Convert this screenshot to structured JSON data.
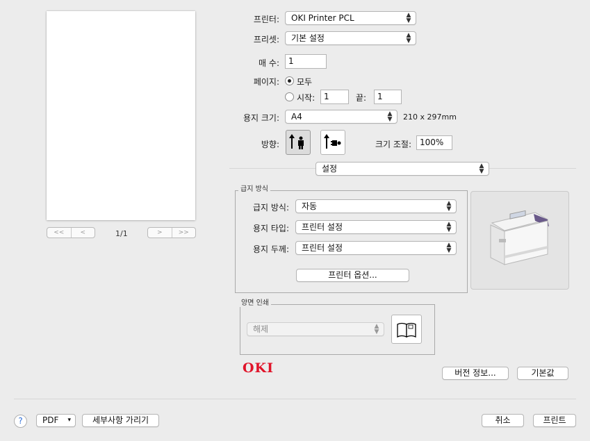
{
  "preview": {
    "page_counter": "1/1"
  },
  "printer": {
    "label": "프린터:",
    "value": "OKI Printer PCL"
  },
  "preset": {
    "label": "프리셋:",
    "value": "기본 설정"
  },
  "copies": {
    "label": "매 수:",
    "value": "1"
  },
  "pages": {
    "label": "페이지:",
    "all_label": "모두",
    "from_label": "시작:",
    "from_value": "1",
    "to_label": "끝:",
    "to_value": "1",
    "selected": "all"
  },
  "paper_size": {
    "label": "용지 크기:",
    "value": "A4",
    "dimensions": "210 x 297mm"
  },
  "orientation": {
    "label": "방향:",
    "selected": "portrait"
  },
  "scale": {
    "label": "크기 조절:",
    "value": "100%"
  },
  "section_menu": {
    "value": "설정"
  },
  "feed_group": {
    "title": "급지 방식",
    "feed_source": {
      "label": "급지 방식:",
      "value": "자동"
    },
    "media_type": {
      "label": "용지 타입:",
      "value": "프린터 설정"
    },
    "media_weight": {
      "label": "용지 두께:",
      "value": "프린터 설정"
    },
    "options_button": "프린터 옵션..."
  },
  "duplex_group": {
    "title": "양면 인쇄",
    "value": "해제"
  },
  "brand": {
    "logo_text": "OKI",
    "color": "#e0142a"
  },
  "buttons": {
    "version_info": "버전 정보...",
    "defaults": "기본값",
    "pdf": "PDF",
    "hide_details": "세부사항 가리기",
    "cancel": "취소",
    "print": "프린트",
    "help": "?"
  }
}
